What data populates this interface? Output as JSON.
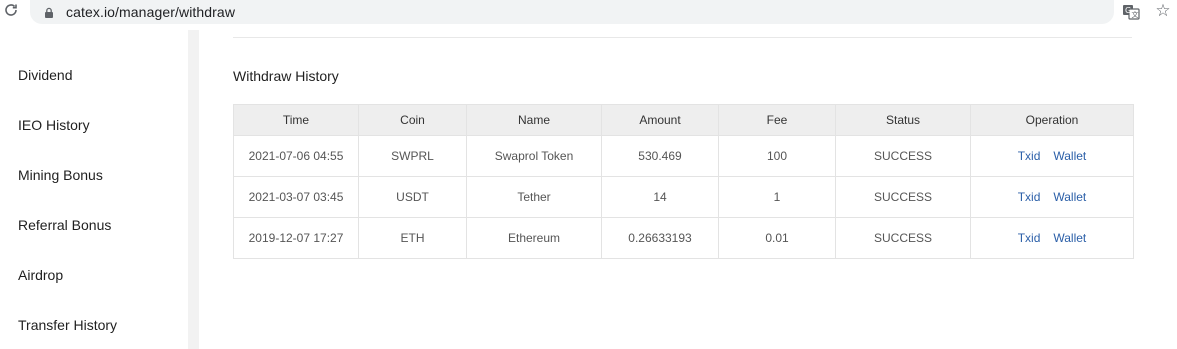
{
  "browser": {
    "url": "catex.io/manager/withdraw",
    "icons": [
      "reload-icon",
      "lock-icon",
      "translate-icon",
      "star-icon"
    ]
  },
  "sidebar": {
    "items": [
      {
        "label": "Dividend"
      },
      {
        "label": "IEO History"
      },
      {
        "label": "Mining Bonus"
      },
      {
        "label": "Referral Bonus"
      },
      {
        "label": "Airdrop"
      },
      {
        "label": "Transfer History"
      }
    ]
  },
  "main": {
    "title": "Withdraw History",
    "table": {
      "columns": [
        "Time",
        "Coin",
        "Name",
        "Amount",
        "Fee",
        "Status",
        "Operation"
      ],
      "rows": [
        {
          "time": "2021-07-06 04:55",
          "coin": "SWPRL",
          "name": "Swaprol Token",
          "amount": "530.469",
          "fee": "100",
          "status": "SUCCESS",
          "txid": "Txid",
          "wallet": "Wallet"
        },
        {
          "time": "2021-03-07 03:45",
          "coin": "USDT",
          "name": "Tether",
          "amount": "14",
          "fee": "1",
          "status": "SUCCESS",
          "txid": "Txid",
          "wallet": "Wallet"
        },
        {
          "time": "2019-12-07 17:27",
          "coin": "ETH",
          "name": "Ethereum",
          "amount": "0.26633193",
          "fee": "0.01",
          "status": "SUCCESS",
          "txid": "Txid",
          "wallet": "Wallet"
        }
      ]
    }
  },
  "colors": {
    "link": "#2b5fa8",
    "header_bg": "#eeeeee",
    "border": "#e3e3e3"
  }
}
